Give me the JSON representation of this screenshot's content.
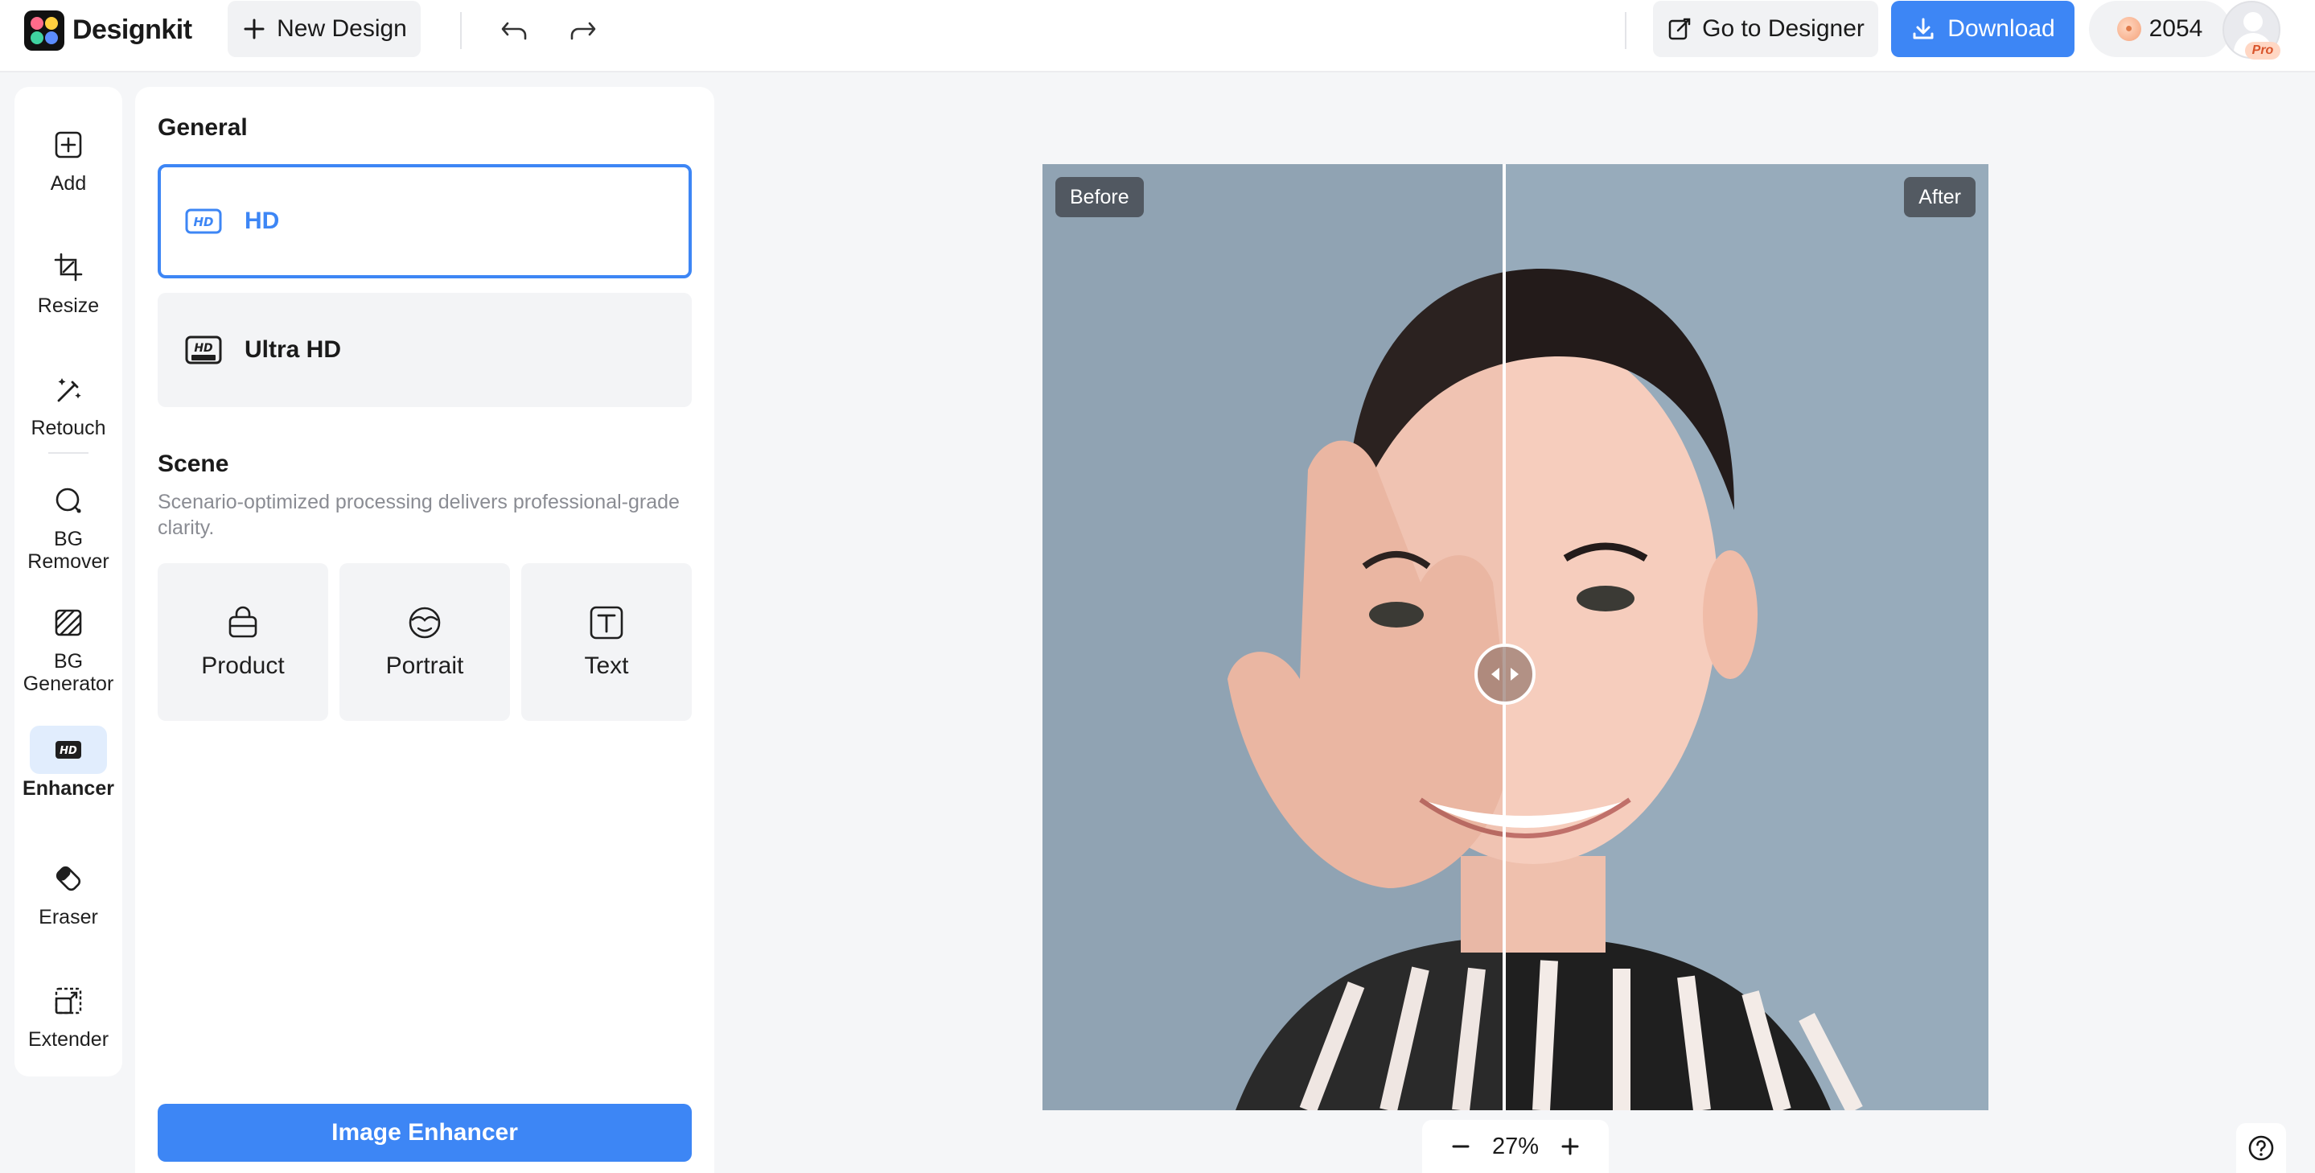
{
  "header": {
    "brand": "Designkit",
    "new_design_label": "New Design",
    "go_to_designer_label": "Go to Designer",
    "download_label": "Download",
    "credits": "2054",
    "pro_badge": "Pro",
    "accent_color": "#3d86f5"
  },
  "sidebar": {
    "items": [
      {
        "label": "Add",
        "icon": "add-square-icon"
      },
      {
        "label": "Resize",
        "icon": "crop-icon"
      },
      {
        "label": "Retouch",
        "icon": "magic-wand-icon"
      },
      {
        "label": "BG Remover",
        "icon": "bg-remover-icon"
      },
      {
        "label": "BG Generator",
        "icon": "bg-generator-icon"
      },
      {
        "label": "Enhancer",
        "icon": "hd-icon",
        "active": true
      },
      {
        "label": "Eraser",
        "icon": "eraser-icon"
      },
      {
        "label": "Extender",
        "icon": "extend-icon"
      }
    ]
  },
  "panel": {
    "general_title": "General",
    "options": [
      {
        "label": "HD",
        "selected": true
      },
      {
        "label": "Ultra HD",
        "selected": false
      }
    ],
    "scene_title": "Scene",
    "scene_description": "Scenario-optimized processing delivers professional-grade clarity.",
    "scenes": [
      {
        "label": "Product",
        "icon": "bag-icon"
      },
      {
        "label": "Portrait",
        "icon": "face-icon"
      },
      {
        "label": "Text",
        "icon": "text-icon"
      }
    ],
    "action_label": "Image Enhancer"
  },
  "canvas": {
    "before_label": "Before",
    "after_label": "After"
  },
  "zoom": {
    "level": "27%"
  }
}
